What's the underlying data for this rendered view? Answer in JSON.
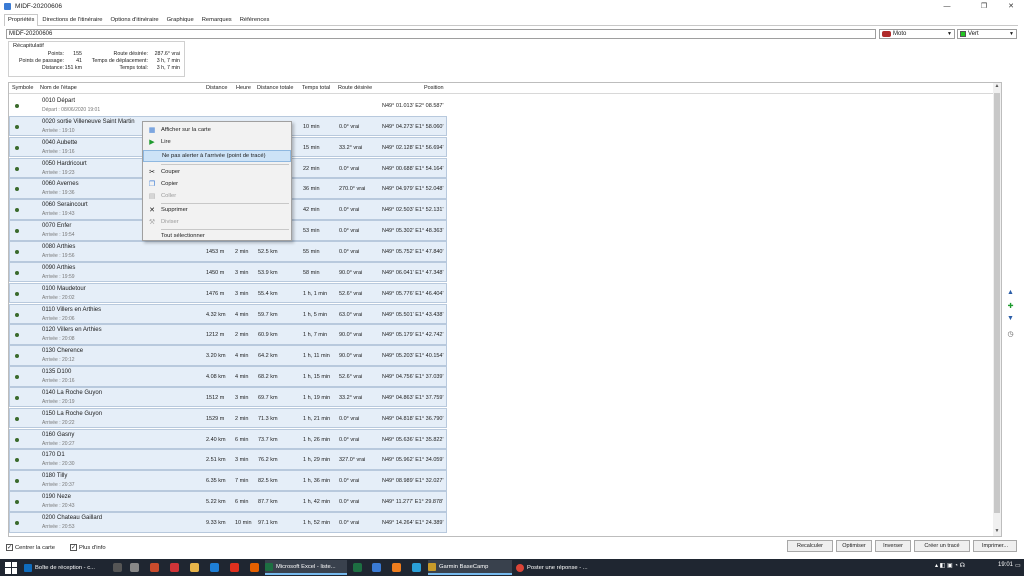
{
  "window": {
    "title": "MIDF-20200606",
    "min": "—",
    "max": "❐",
    "close": "✕"
  },
  "tabs": [
    "Propriétés",
    "Directions de l'itinéraire",
    "Options d'itinéraire",
    "Graphique",
    "Remarques",
    "Références"
  ],
  "route_name": "MIDF-20200606",
  "profile": {
    "label": "Moto",
    "icon": "motorcycle-icon"
  },
  "color": {
    "label": "Vert",
    "value": "#22c522"
  },
  "recap": {
    "title": "Récapitulatif",
    "points_label": "Points:",
    "points": "155",
    "waypoints_label": "Points de passage:",
    "waypoints": "41",
    "distance_label": "Distance:",
    "distance": "151 km",
    "desired_label": "Route désirée:",
    "desired": "287.6° vrai",
    "move_label": "Temps de déplacement:",
    "move": "3 h, 7 min",
    "total_label": "Temps total:",
    "total": "3 h, 7 min"
  },
  "columns": [
    "Symbole",
    "Nom de l'étape",
    "Distance",
    "Heure",
    "Distance totale",
    "Temps total",
    "Route désirée",
    "Position"
  ],
  "rows": [
    {
      "name": "0010 Départ",
      "sub": "Départ : 08/06/2020 19:01",
      "dist": "",
      "time": "",
      "total": "",
      "ttime": "",
      "route": "",
      "pos": "N49° 01.013' E2° 08.587'"
    },
    {
      "name": "0020 sortie Villeneuve Saint Martin",
      "sub": "Arrivée : 19:10",
      "dist": "",
      "time": "",
      "total": "",
      "ttime": "10 min",
      "route": "0.0° vrai",
      "pos": "N49° 04.273' E1° 58.060'"
    },
    {
      "name": "0040 Aubette",
      "sub": "Arrivée : 19:16",
      "dist": "",
      "time": "",
      "total": "",
      "ttime": "15 min",
      "route": "33.2° vrai",
      "pos": "N49° 02.128' E1° 56.694'"
    },
    {
      "name": "0050 Hardricourt",
      "sub": "Arrivée : 19:23",
      "dist": "",
      "time": "",
      "total": "",
      "ttime": "22 min",
      "route": "0.0° vrai",
      "pos": "N49° 00.688' E1° 54.164'"
    },
    {
      "name": "0060 Avernes",
      "sub": "Arrivée : 19:36",
      "dist": "",
      "time": "",
      "total": "",
      "ttime": "36 min",
      "route": "270.0° vrai",
      "pos": "N49° 04.979' E1° 52.048'"
    },
    {
      "name": "0060 Seraincourt",
      "sub": "Arrivée : 19:43",
      "dist": "",
      "time": "",
      "total": "",
      "ttime": "42 min",
      "route": "0.0° vrai",
      "pos": "N49° 02.503' E1° 52.131'"
    },
    {
      "name": "0070 Enfer",
      "sub": "Arrivée : 19:54",
      "dist": "",
      "time": "",
      "total": "",
      "ttime": "53 min",
      "route": "0.0° vrai",
      "pos": "N49° 05.302' E1° 48.363'"
    },
    {
      "name": "0080 Arthies",
      "sub": "Arrivée : 19:56",
      "dist": "1453 m",
      "time": "2 min",
      "total": "52.5 km",
      "ttime": "55 min",
      "route": "0.0° vrai",
      "pos": "N49° 05.752' E1° 47.840'"
    },
    {
      "name": "0090 Arthies",
      "sub": "Arrivée : 19:59",
      "dist": "1450 m",
      "time": "3 min",
      "total": "53.9 km",
      "ttime": "58 min",
      "route": "90.0° vrai",
      "pos": "N49° 06.041' E1° 47.348'"
    },
    {
      "name": "0100 Maudetour",
      "sub": "Arrivée : 20:02",
      "dist": "1476 m",
      "time": "3 min",
      "total": "55.4 km",
      "ttime": "1 h, 1 min",
      "route": "52.6° vrai",
      "pos": "N49° 05.776' E1° 46.404'"
    },
    {
      "name": "0110 Villers en Arthies",
      "sub": "Arrivée : 20:06",
      "dist": "4.32 km",
      "time": "4 min",
      "total": "59.7 km",
      "ttime": "1 h, 5 min",
      "route": "63.0° vrai",
      "pos": "N49° 05.501' E1° 43.438'"
    },
    {
      "name": "0120 Villers en Arthies",
      "sub": "Arrivée : 20:08",
      "dist": "1212 m",
      "time": "2 min",
      "total": "60.9 km",
      "ttime": "1 h, 7 min",
      "route": "90.0° vrai",
      "pos": "N49° 05.179' E1° 42.742'"
    },
    {
      "name": "0130 Cherence",
      "sub": "Arrivée : 20:12",
      "dist": "3.20 km",
      "time": "4 min",
      "total": "64.2 km",
      "ttime": "1 h, 11 min",
      "route": "90.0° vrai",
      "pos": "N49° 05.203' E1° 40.154'"
    },
    {
      "name": "0135 D100",
      "sub": "Arrivée : 20:16",
      "dist": "4.08 km",
      "time": "4 min",
      "total": "68.2 km",
      "ttime": "1 h, 15 min",
      "route": "52.6° vrai",
      "pos": "N49° 04.756' E1° 37.039'"
    },
    {
      "name": "0140 La Roche Guyon",
      "sub": "Arrivée : 20:19",
      "dist": "1512 m",
      "time": "3 min",
      "total": "69.7 km",
      "ttime": "1 h, 19 min",
      "route": "33.2° vrai",
      "pos": "N49° 04.863' E1° 37.759'"
    },
    {
      "name": "0150 La Roche Guyon",
      "sub": "Arrivée : 20:22",
      "dist": "1529 m",
      "time": "2 min",
      "total": "71.3 km",
      "ttime": "1 h, 21 min",
      "route": "0.0° vrai",
      "pos": "N49° 04.818' E1° 36.790'"
    },
    {
      "name": "0160 Gasny",
      "sub": "Arrivée : 20:27",
      "dist": "2.40 km",
      "time": "6 min",
      "total": "73.7 km",
      "ttime": "1 h, 26 min",
      "route": "0.0° vrai",
      "pos": "N49° 05.636' E1° 35.822'"
    },
    {
      "name": "0170 D1",
      "sub": "Arrivée : 20:30",
      "dist": "2.51 km",
      "time": "3 min",
      "total": "76.2 km",
      "ttime": "1 h, 29 min",
      "route": "327.0° vrai",
      "pos": "N49° 05.962' E1° 34.059'"
    },
    {
      "name": "0180 Tilly",
      "sub": "Arrivée : 20:37",
      "dist": "6.35 km",
      "time": "7 min",
      "total": "82.5 km",
      "ttime": "1 h, 36 min",
      "route": "0.0° vrai",
      "pos": "N49° 08.989' E1° 32.027'"
    },
    {
      "name": "0190 Neze",
      "sub": "Arrivée : 20:43",
      "dist": "5.22 km",
      "time": "6 min",
      "total": "87.7 km",
      "ttime": "1 h, 42 min",
      "route": "0.0° vrai",
      "pos": "N49° 11.277' E1° 29.878'"
    },
    {
      "name": "0200 Chateau Gaillard",
      "sub": "Arrivée : 20:53",
      "dist": "9.33 km",
      "time": "10 min",
      "total": "97.1 km",
      "ttime": "1 h, 52 min",
      "route": "0.0° vrai",
      "pos": "N49° 14.264' E1° 24.389'"
    }
  ],
  "context_menu": [
    {
      "label": "Afficher sur la carte",
      "icon": "map-icon"
    },
    {
      "label": "Lire",
      "icon": "play-icon"
    },
    {
      "label": "Ne pas alerter à l'arrivée (point de tracé)",
      "icon": "",
      "highlight": true
    },
    {
      "label": "Couper",
      "icon": "scissors-icon"
    },
    {
      "label": "Copier",
      "icon": "copy-icon"
    },
    {
      "label": "Coller",
      "icon": "paste-icon",
      "disabled": true
    },
    {
      "label": "Supprimer",
      "icon": "delete-icon"
    },
    {
      "label": "Diviser",
      "icon": "split-icon",
      "disabled": true
    },
    {
      "label": "Tout sélectionner",
      "icon": ""
    }
  ],
  "side_buttons": [
    "▲",
    "✚",
    "▼",
    "◷"
  ],
  "bottom": {
    "center_map": "Centrer la carte",
    "more_info": "Plus d'info",
    "buttons": [
      "Recalculer",
      "Optimiser",
      "Inverser",
      "Créer un tracé",
      "Imprimer..."
    ]
  },
  "taskbar": {
    "items": [
      "Boîte de réception - c...",
      "Microsoft Excel - liste...",
      "Garmin BaseCamp",
      "Poster une réponse - ..."
    ],
    "clock": "19:01"
  }
}
